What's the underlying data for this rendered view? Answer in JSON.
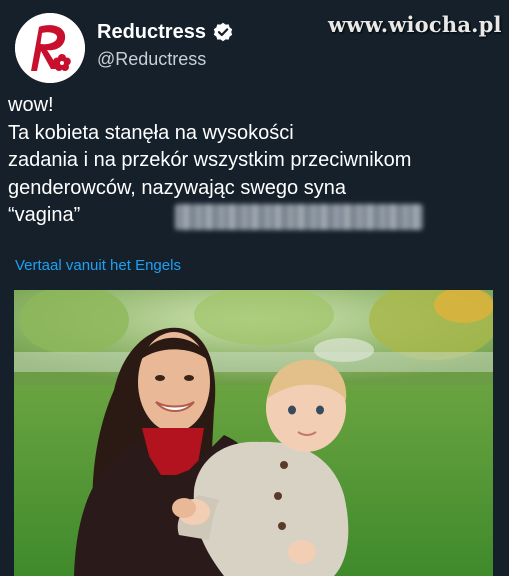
{
  "watermark": "www.wiocha.pl",
  "author": {
    "name": "Reductress",
    "handle": "@Reductress",
    "verified": true,
    "avatar_icon": "reductress-logo-icon",
    "verified_icon": "verified-badge-icon"
  },
  "tweet": {
    "lines": [
      "wow!",
      "Ta kobieta stanęła na wysokości",
      "zadania i na przekór wszystkim przeciwnikom",
      "genderowców, nazywając swego syna",
      "“vagina”"
    ],
    "translate_label": "Vertaal vanuit het Engels",
    "photo_icon": "mother-and-baby-photo"
  },
  "colors": {
    "background": "#15202b",
    "link": "#1da1f2",
    "brand_red": "#c8102e"
  }
}
